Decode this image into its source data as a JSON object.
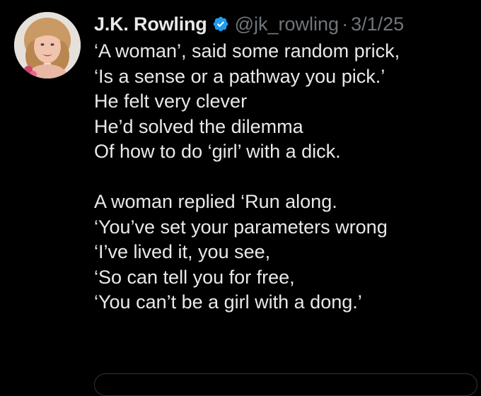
{
  "author": {
    "display_name": "J.K. Rowling",
    "handle": "@jk_rowling",
    "separator": "·",
    "date": "3/1/25",
    "verified_icon": "verified-badge-icon",
    "avatar_icon": "profile-photo"
  },
  "tweet": {
    "stanza1": [
      "‘A woman’, said some random prick,",
      "‘Is a sense or a pathway you pick.’",
      "He felt very clever",
      "He’d solved the dilemma",
      "Of how to do ‘girl’ with a dick."
    ],
    "stanza2": [
      "A woman replied ‘Run along.",
      "‘You’ve set your parameters wrong",
      "‘I’ve lived it, you see,",
      "‘So can tell you for free,",
      "‘You can’t be a girl with a dong.’"
    ]
  },
  "colors": {
    "background": "#000000",
    "text_primary": "#e7e9ea",
    "text_secondary": "#71767b",
    "verified_blue": "#1d9bf0",
    "border": "#2f3336"
  }
}
